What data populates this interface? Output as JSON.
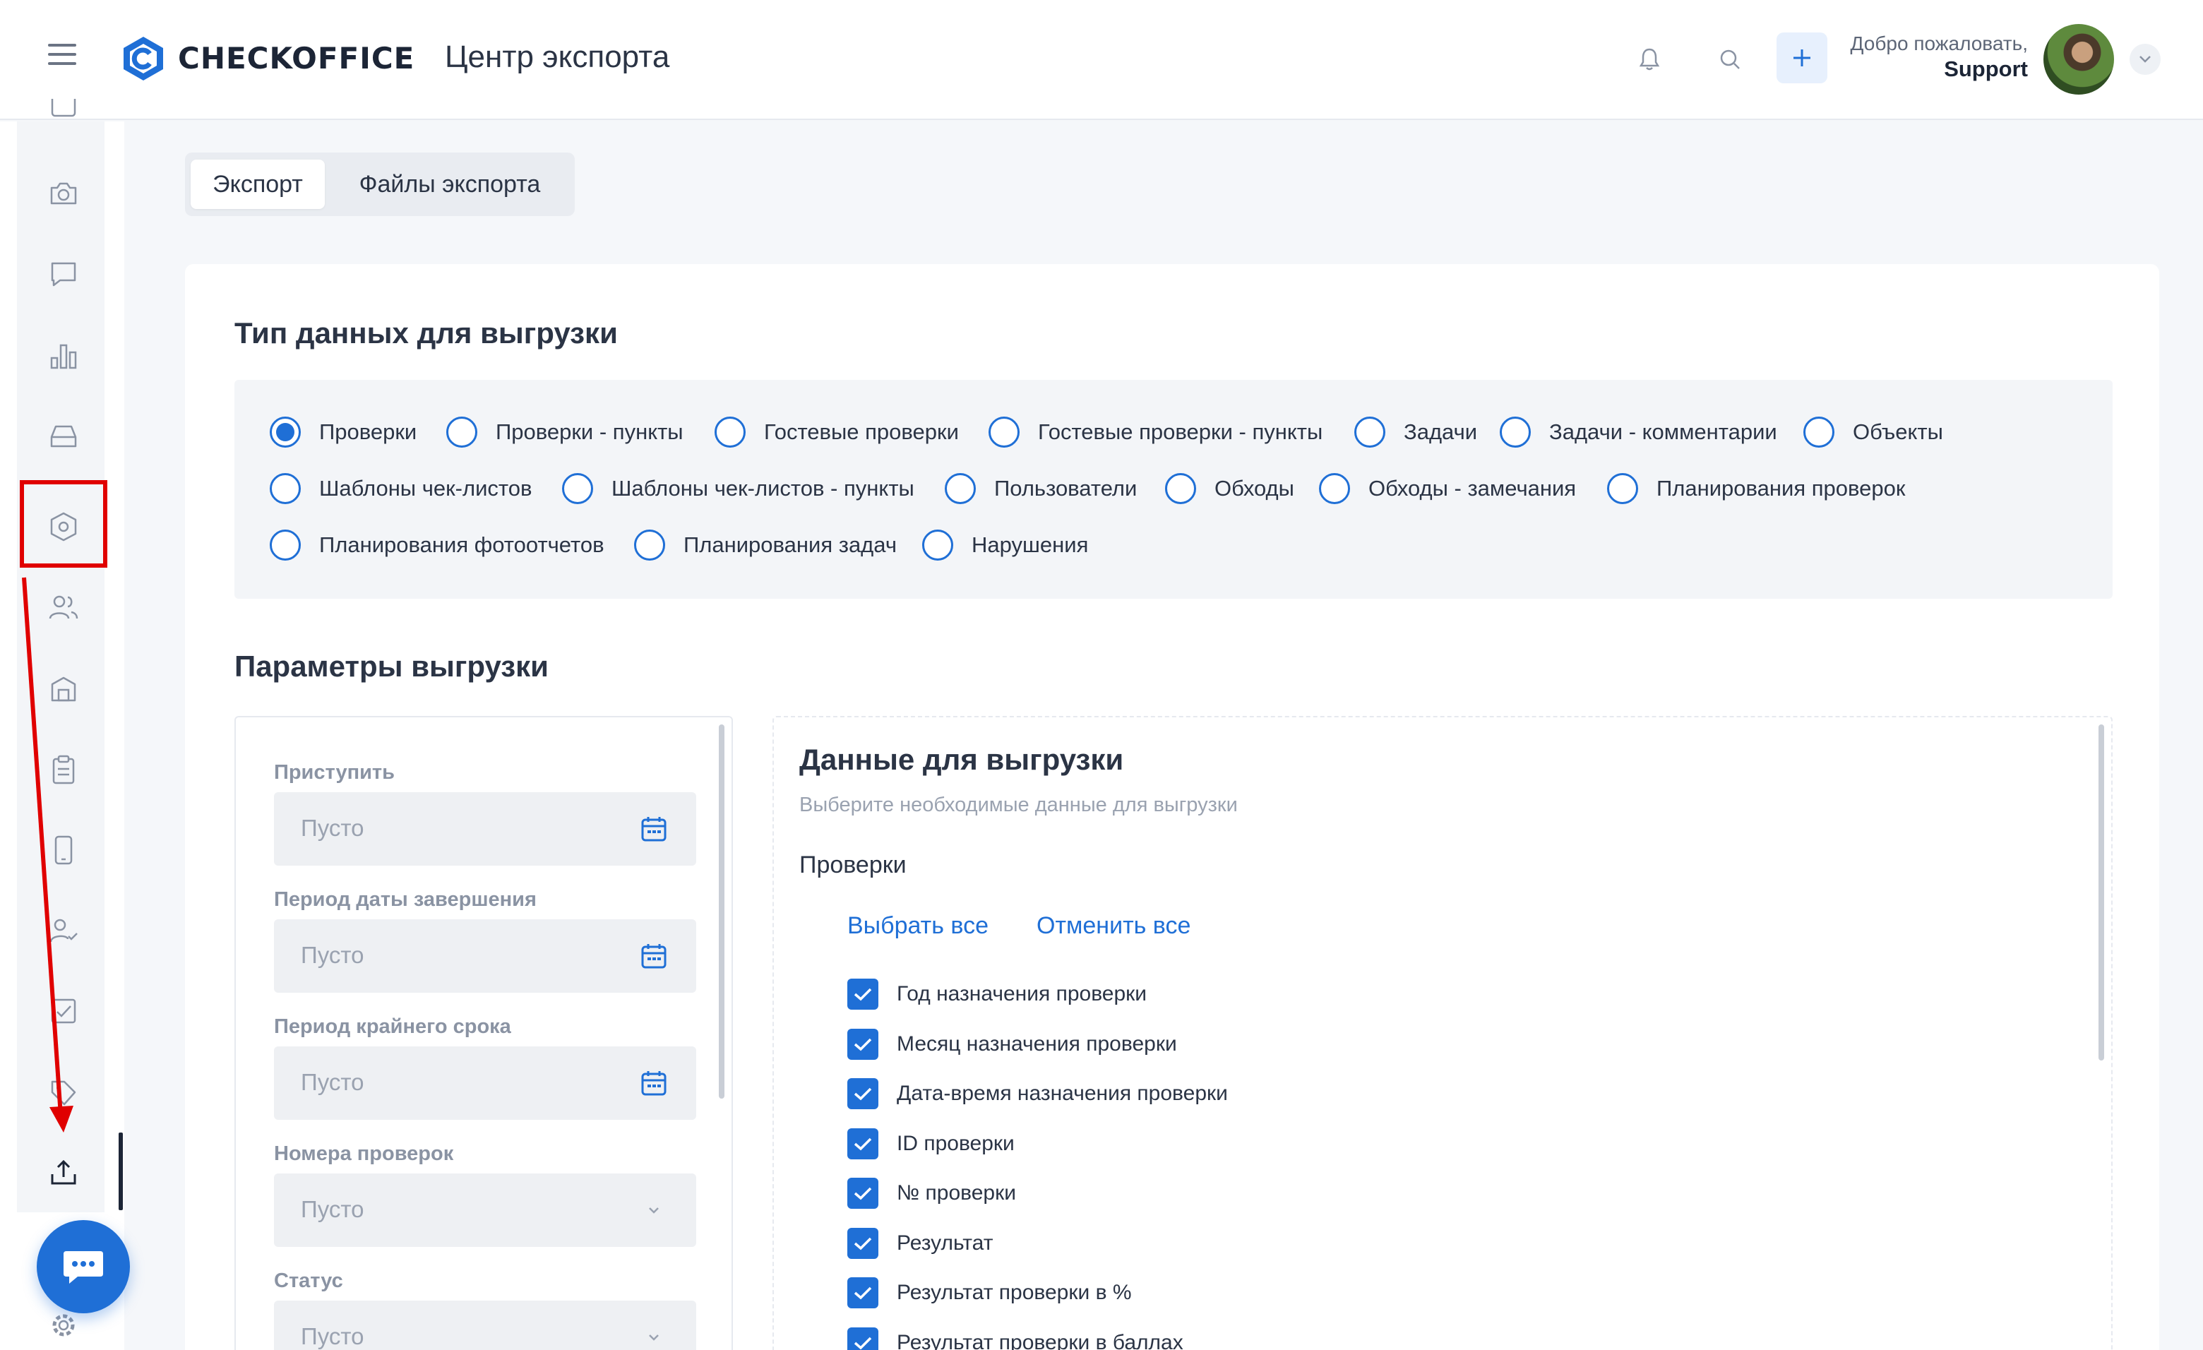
{
  "header": {
    "logo_text": "CHECKOFFICE",
    "page_title": "Центр экспорта",
    "welcome_text": "Добро пожаловать,",
    "user_name": "Support"
  },
  "tabs": [
    {
      "label": "Экспорт",
      "active": true
    },
    {
      "label": "Файлы экспорта",
      "active": false
    }
  ],
  "data_type": {
    "title": "Тип данных для выгрузки",
    "options": [
      {
        "label": "Проверки",
        "selected": true
      },
      {
        "label": "Проверки - пункты",
        "selected": false
      },
      {
        "label": "Гостевые проверки",
        "selected": false
      },
      {
        "label": "Гостевые проверки - пункты",
        "selected": false
      },
      {
        "label": "Задачи",
        "selected": false
      },
      {
        "label": "Задачи - комментарии",
        "selected": false
      },
      {
        "label": "Объекты",
        "selected": false
      },
      {
        "label": "Шаблоны чек-листов",
        "selected": false
      },
      {
        "label": "Шаблоны чек-листов - пункты",
        "selected": false
      },
      {
        "label": "Пользователи",
        "selected": false
      },
      {
        "label": "Обходы",
        "selected": false
      },
      {
        "label": "Обходы - замечания",
        "selected": false
      },
      {
        "label": "Планирования проверок",
        "selected": false
      },
      {
        "label": "Планирования фотоотчетов",
        "selected": false
      },
      {
        "label": "Планирования задач",
        "selected": false
      },
      {
        "label": "Нарушения",
        "selected": false
      }
    ]
  },
  "params": {
    "title": "Параметры выгрузки",
    "filters": [
      {
        "label": "Приступить",
        "placeholder": "Пусто",
        "icon": "calendar-icon"
      },
      {
        "label": "Период даты завершения",
        "placeholder": "Пусто",
        "icon": "calendar-icon"
      },
      {
        "label": "Период крайнего срока",
        "placeholder": "Пусто",
        "icon": "calendar-icon"
      },
      {
        "label": "Номера проверок",
        "placeholder": "Пусто",
        "icon": "chevron-down-icon"
      },
      {
        "label": "Статус",
        "placeholder": "Пусто",
        "icon": "chevron-down-icon"
      }
    ]
  },
  "export_data": {
    "title": "Данные для выгрузки",
    "subtitle": "Выберите необходимые данные для выгрузки",
    "group": "Проверки",
    "select_all": "Выбрать все",
    "deselect_all": "Отменить все",
    "fields": [
      {
        "label": "Год назначения проверки",
        "checked": true
      },
      {
        "label": "Месяц назначения проверки",
        "checked": true
      },
      {
        "label": "Дата-время назначения проверки",
        "checked": true
      },
      {
        "label": "ID проверки",
        "checked": true
      },
      {
        "label": "№ проверки",
        "checked": true
      },
      {
        "label": "Результат",
        "checked": true
      },
      {
        "label": "Результат проверки в %",
        "checked": true
      },
      {
        "label": "Результат проверки в баллах",
        "checked": true
      }
    ]
  },
  "sidebar": {
    "items": [
      "calendar-icon",
      "camera-icon",
      "chat-icon",
      "bar-chart-icon",
      "inbox-icon",
      "settings-hex-icon",
      "users-icon",
      "building-icon",
      "clipboard-icon",
      "mobile-icon",
      "user-check-icon",
      "check-square-icon",
      "tag-icon",
      "upload-icon"
    ],
    "active": "upload-icon",
    "highlighted": "settings-hex-icon"
  },
  "colors": {
    "accent": "#1f6fd6",
    "annotation": "#e00000"
  }
}
